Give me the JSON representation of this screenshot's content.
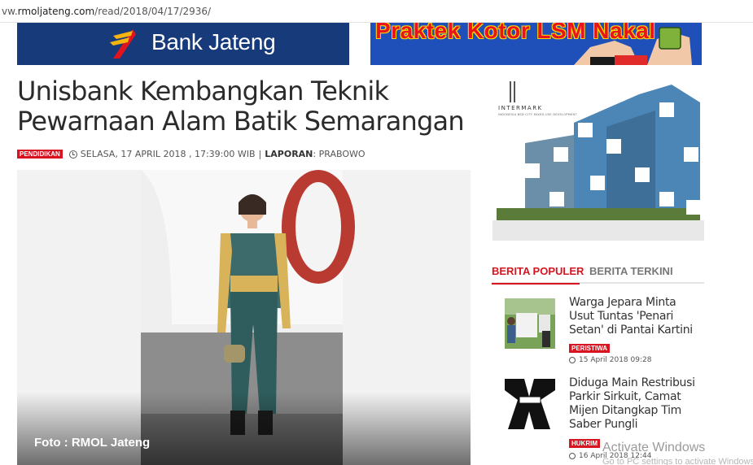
{
  "browser": {
    "url_prefix": "vw.",
    "url_host": "rmoljateng.com",
    "url_path": "/read/2018/04/17/2936/"
  },
  "banners": {
    "left": {
      "text": "Bank Jateng",
      "bg": "#173a7a"
    },
    "right": {
      "text": "Praktek Kotor LSM Nakal",
      "bg": "#1f4fb8"
    }
  },
  "article": {
    "title": "Unisbank Kembangkan Teknik Pewarnaan Alam Batik Semarangan",
    "category": "PENDIDIKAN",
    "date": "SELASA, 17 APRIL 2018 , 17:39:00 WIB",
    "separator": "|",
    "reporter_label": "LAPORAN",
    "reporter_colon": ":",
    "reporter": "PRABOWO",
    "photo_caption": "Foto : RMOL Jateng"
  },
  "ad": {
    "brand": "INTERMARK",
    "tagline": "INDONESIA BSD CITY MIXED-USE DEVELOPMENT"
  },
  "sidebar": {
    "tabs": [
      {
        "label": "BERITA POPULER",
        "active": true
      },
      {
        "label": "BERITA TERKINI",
        "active": false
      }
    ],
    "items": [
      {
        "title": "Warga Jepara Minta Usut Tuntas 'Penari Setan' di Pantai Kartini",
        "category": "PERISTIWA",
        "date": "15 April 2018 09:28",
        "icon": "clock-icon"
      },
      {
        "title": "Diduga Main Restribusi Parkir Sirkuit, Camat Mijen Ditangkap Tim Saber Pungli",
        "category": "HUKRIM",
        "date": "16 April 2018 12:44",
        "icon": "clock-icon"
      }
    ]
  },
  "watermark": {
    "line1": "Activate Windows",
    "line2": "Go to PC settings to activate Windows."
  },
  "colors": {
    "accent": "#d7141f",
    "title": "#2b2b2b"
  }
}
